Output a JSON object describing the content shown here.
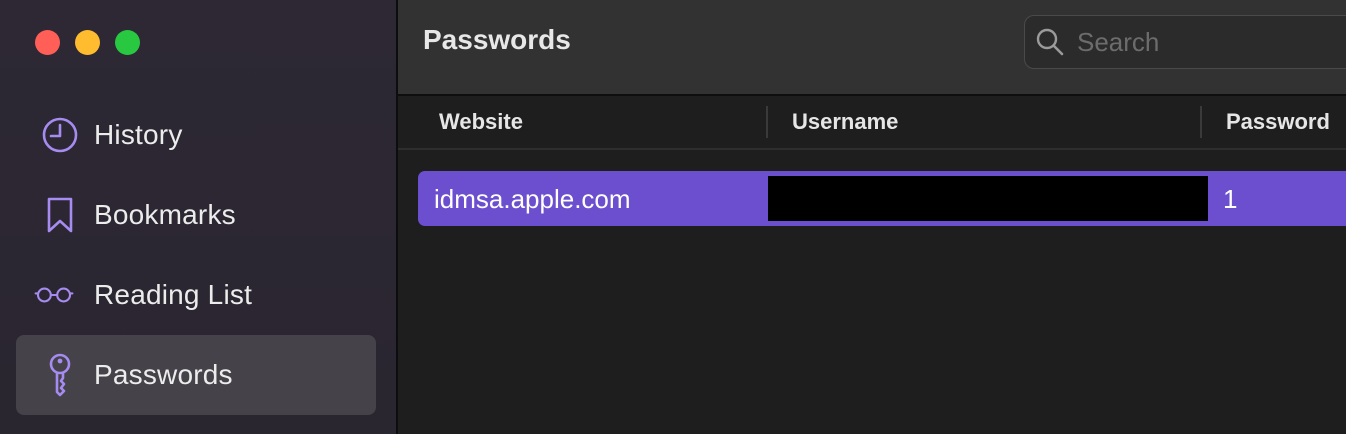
{
  "sidebar": {
    "items": [
      {
        "label": "History",
        "icon": "clock-icon"
      },
      {
        "label": "Bookmarks",
        "icon": "bookmark-icon"
      },
      {
        "label": "Reading List",
        "icon": "glasses-icon"
      },
      {
        "label": "Passwords",
        "icon": "key-icon",
        "selected": true
      }
    ]
  },
  "header": {
    "title": "Passwords"
  },
  "search": {
    "placeholder": "Search",
    "value": ""
  },
  "table": {
    "columns": [
      "Website",
      "Username",
      "Password"
    ],
    "rows": [
      {
        "website": "idmsa.apple.com",
        "username": "",
        "password": "1",
        "selected": true
      }
    ]
  },
  "colors": {
    "accent": "#6b4fcf",
    "icon": "#a68bf0",
    "sidebar_bg": "#2d2834"
  }
}
